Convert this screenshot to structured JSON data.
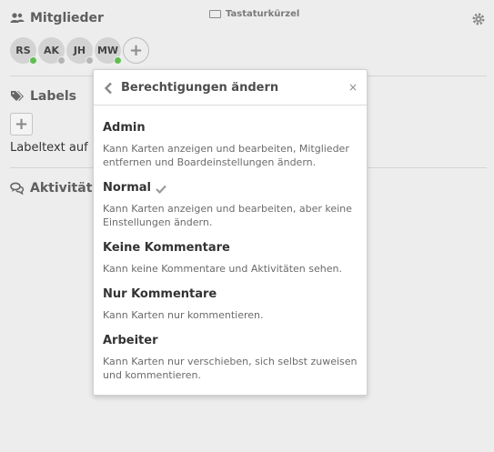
{
  "members_section": {
    "title": "Mitglieder",
    "avatars": [
      {
        "initials": "RS",
        "status": "online"
      },
      {
        "initials": "AK",
        "status": "offline"
      },
      {
        "initials": "JH",
        "status": "offline"
      },
      {
        "initials": "MW",
        "status": "online"
      }
    ],
    "add_label": "+"
  },
  "shortcuts": {
    "label": "Tastaturkürzel"
  },
  "labels_section": {
    "title": "Labels",
    "add_label": "+",
    "label_text": "Labeltext auf M"
  },
  "activity_section": {
    "title": "Aktivitäten"
  },
  "popover": {
    "title": "Berechtigungen ändern",
    "close": "×",
    "options": [
      {
        "name": "Admin",
        "description": "Kann Karten anzeigen und bearbeiten, Mitglieder entfernen und Boardeinstellungen ändern.",
        "selected": false
      },
      {
        "name": "Normal",
        "description": "Kann Karten anzeigen und bearbeiten, aber keine Einstellungen ändern.",
        "selected": true
      },
      {
        "name": "Keine Kommentare",
        "description": "Kann keine Kommentare und Aktivitäten sehen.",
        "selected": false
      },
      {
        "name": "Nur Kommentare",
        "description": "Kann Karten nur kommentieren.",
        "selected": false
      },
      {
        "name": "Arbeiter",
        "description": "Kann Karten nur verschieben, sich selbst zuweisen und kommentieren.",
        "selected": false
      }
    ]
  },
  "colors": {
    "online": "#61bd4f",
    "offline": "#b5b5b5",
    "background": "#ededed"
  }
}
